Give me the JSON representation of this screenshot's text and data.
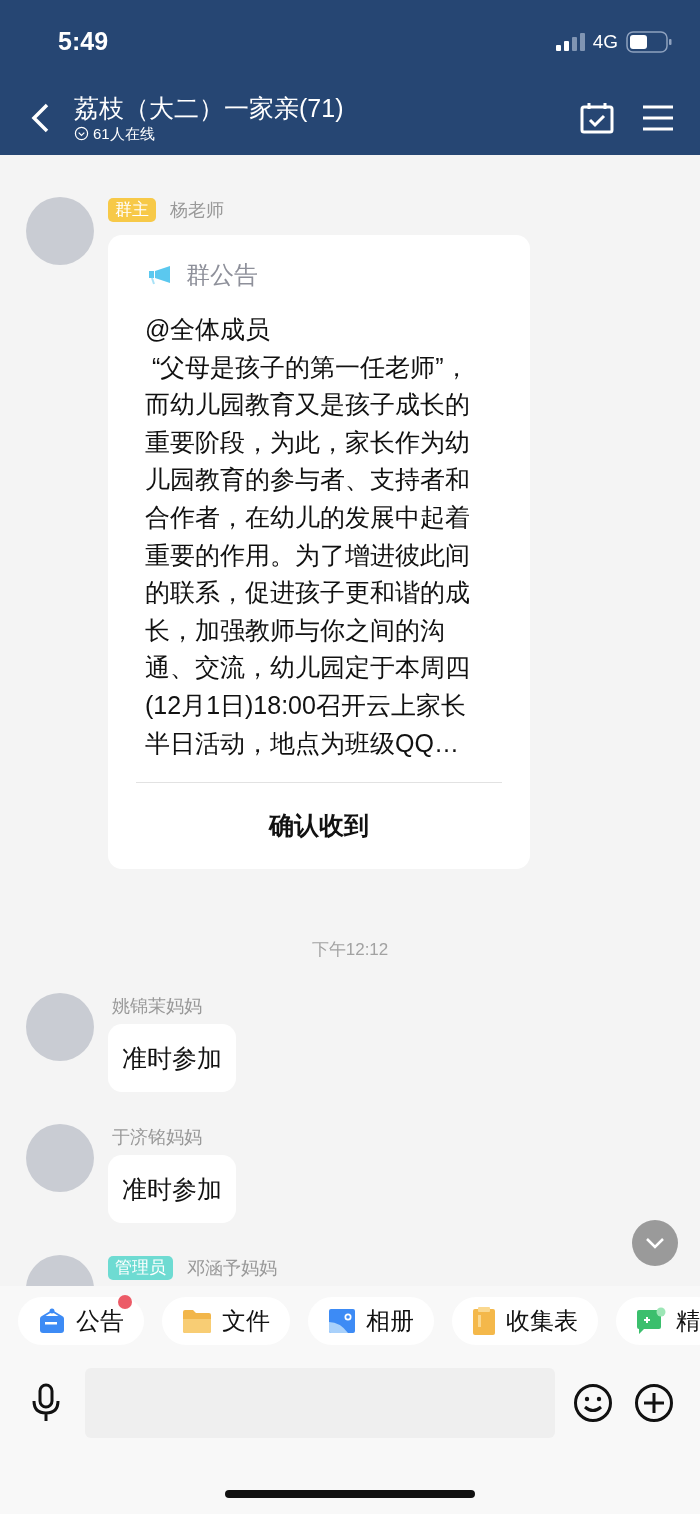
{
  "status_bar": {
    "time": "5:49",
    "network": "4G"
  },
  "header": {
    "title": "荔枝（大二）一家亲(71)",
    "online": "61人在线"
  },
  "messages": [
    {
      "kind": "notice",
      "badge": {
        "label": "群主",
        "color": "#f7c948"
      },
      "sender": "杨老师",
      "notice_title": "群公告",
      "body": "@全体成员\n “父母是孩子的第一任老师”，而幼儿园教育又是孩子成长的重要阶段，为此，家长作为幼儿园教育的参与者、支持者和合作者，在幼儿的发展中起着重要的作用。为了增进彼此间的联系，促进孩子更和谐的成长，加强教师与你之间的沟通、交流，幼儿园定于本周四(12月1日)18:00召开云上家长半日活动，地点为班级QQ…",
      "action": "确认收到"
    },
    {
      "kind": "time",
      "text": "下午12:12"
    },
    {
      "kind": "text",
      "sender": "姚锦茉妈妈",
      "text": "准时参加"
    },
    {
      "kind": "text",
      "sender": "于济铭妈妈",
      "text": "准时参加"
    },
    {
      "kind": "partial",
      "badge": {
        "label": "管理员",
        "color": "#6edbd2"
      },
      "sender": "邓涵予妈妈"
    }
  ],
  "toolbar": [
    {
      "kind": "notice",
      "label": "公告",
      "unread": true
    },
    {
      "kind": "folder",
      "label": "文件",
      "unread": false
    },
    {
      "kind": "album",
      "label": "相册",
      "unread": false
    },
    {
      "kind": "form",
      "label": "收集表",
      "unread": false
    },
    {
      "kind": "essence",
      "label": "精",
      "unread": false
    }
  ]
}
